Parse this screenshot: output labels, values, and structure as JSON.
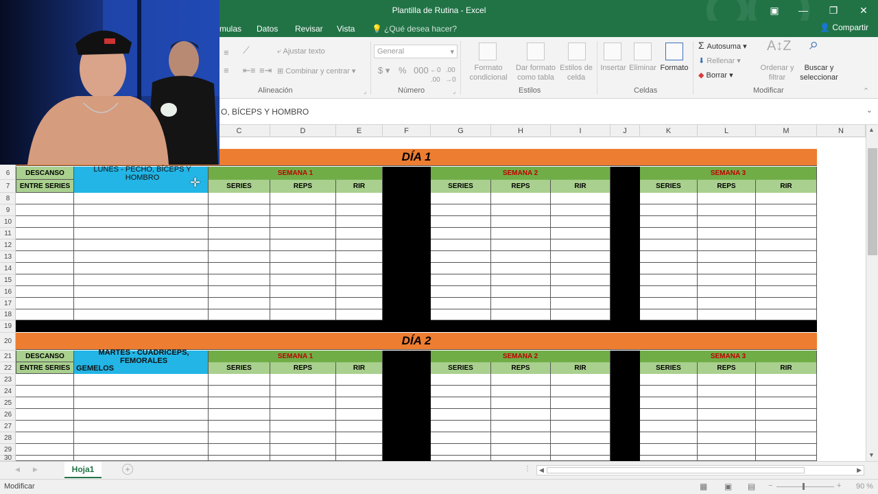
{
  "window": {
    "title": "Plantilla de Rutina - Excel",
    "share_label": "Compartir"
  },
  "tabs": [
    "mulas",
    "Datos",
    "Revisar",
    "Vista"
  ],
  "tell_me": "¿Qué desea hacer?",
  "ribbon": {
    "wrap_text": "Ajustar texto",
    "merge_center": "Combinar y centrar",
    "alignment_label": "Alineación",
    "number_format": "General",
    "number_label": "Número",
    "conditional_format": "Formato condicional",
    "format_table": "Dar formato como tabla",
    "cell_styles": "Estilos de celda",
    "styles_label": "Estilos",
    "insert": "Insertar",
    "delete": "Eliminar",
    "format": "Formato",
    "cells_label": "Celdas",
    "autosum": "Autosuma",
    "fill": "Rellenar",
    "clear": "Borrar",
    "sort_filter": "Ordenar y filtrar",
    "find_select": "Buscar y seleccionar",
    "modify_label": "Modificar"
  },
  "formula_bar": {
    "content": "O, BÍCEPS Y HOMBRO"
  },
  "columns": [
    "C",
    "D",
    "E",
    "F",
    "G",
    "H",
    "I",
    "J",
    "K",
    "L",
    "M",
    "N"
  ],
  "rows": [
    "6",
    "7",
    "8",
    "9",
    "10",
    "11",
    "12",
    "13",
    "14",
    "15",
    "16",
    "17",
    "18",
    "19",
    "20",
    "21",
    "22",
    "23",
    "24",
    "25",
    "26",
    "27",
    "28",
    "29",
    "30"
  ],
  "sheet": {
    "day1": "DÍA 1",
    "day2": "DÍA 2",
    "rest": "DESCANSO",
    "between_sets": "ENTRE SERIES",
    "day1_routine": "LUNES - PECHO, BÍCEPS Y HOMBRO",
    "day2_routine_line1": "MARTES - CUADRICEPS, FEMORALES",
    "day2_routine_line2": "GEMELOS",
    "week1": "SEMANA 1",
    "week2": "SEMANA 2",
    "week3": "SEMANA 3",
    "series": "SERIES",
    "reps": "REPS",
    "rir": "RIR"
  },
  "sheet_tabs": {
    "active": "Hoja1"
  },
  "statusbar": {
    "mode": "Modificar",
    "zoom": "90 %"
  },
  "colors": {
    "excel_green": "#217346",
    "orange": "#ed7d31",
    "week_green": "#70ad47",
    "header_lightgreen": "#a9d08e",
    "routine_blue": "#22b5e6",
    "week_text_red": "#c00000"
  }
}
